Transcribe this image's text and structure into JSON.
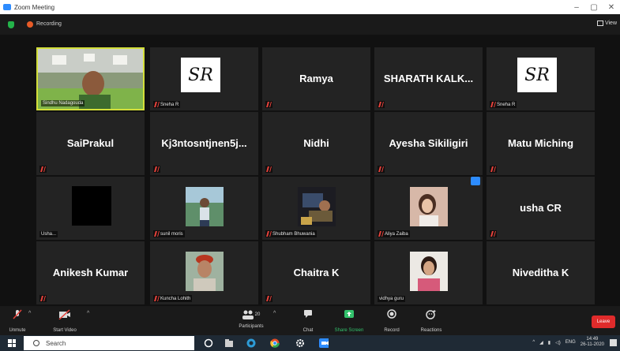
{
  "window": {
    "title": "Zoom Meeting",
    "controls": [
      "–",
      "▢",
      "✕"
    ]
  },
  "topbar": {
    "recording_label": "Recording",
    "view_label": "View"
  },
  "tiles": [
    {
      "id": "r1c1",
      "type": "video",
      "tag": "Sindhu Nadagouda"
    },
    {
      "id": "r1c2",
      "type": "logo",
      "logo_text": "SR",
      "tag": "Sneha R"
    },
    {
      "id": "r1c3",
      "type": "name",
      "name": "Ramya"
    },
    {
      "id": "r1c4",
      "type": "name",
      "name": "SHARATH KALK..."
    },
    {
      "id": "r1c5",
      "type": "logo",
      "logo_text": "SR",
      "tag": "Sneha R"
    },
    {
      "id": "r2c1",
      "type": "name",
      "name": "SaiPrakul"
    },
    {
      "id": "r2c2",
      "type": "name",
      "name": "Kj3ntosntjnen5j..."
    },
    {
      "id": "r2c3",
      "type": "name",
      "name": "Nidhi"
    },
    {
      "id": "r2c4",
      "type": "name",
      "name": "Ayesha Sikiligiri"
    },
    {
      "id": "r2c5",
      "type": "name",
      "name": "Matu Miching"
    },
    {
      "id": "r3c1",
      "type": "black",
      "tag": "Usha..."
    },
    {
      "id": "r3c2",
      "type": "photo",
      "tag": "sunil moris"
    },
    {
      "id": "r3c3",
      "type": "photo",
      "tag": "Shubham Bhuwania"
    },
    {
      "id": "r3c4",
      "type": "photo",
      "tag": "Aliya Zaiba"
    },
    {
      "id": "r3c5",
      "type": "name",
      "name": "usha CR"
    },
    {
      "id": "r4c1",
      "type": "name",
      "name": "Anikesh Kumar"
    },
    {
      "id": "r4c2",
      "type": "photo",
      "tag": "Kuncha Lohith"
    },
    {
      "id": "r4c3",
      "type": "name",
      "name": "Chaitra K"
    },
    {
      "id": "r4c4",
      "type": "photo",
      "tag": "vidhya guru"
    },
    {
      "id": "r4c5",
      "type": "name",
      "name": "Niveditha K"
    }
  ],
  "controls": {
    "unmute": "Unmute",
    "start_video": "Start Video",
    "participants": "Participants",
    "participants_count": "20",
    "chat": "Chat",
    "share_screen": "Share Screen",
    "record": "Record",
    "reactions": "Reactions",
    "leave": "Leave"
  },
  "taskbar": {
    "search_placeholder": "Search",
    "language": "ENG",
    "time": "14:49",
    "date": "26-11-2020"
  },
  "colors": {
    "active_border": "#d3df3a",
    "leave": "#e02b2b",
    "share_green": "#33c26c",
    "zoom_blue": "#2d8cff"
  }
}
